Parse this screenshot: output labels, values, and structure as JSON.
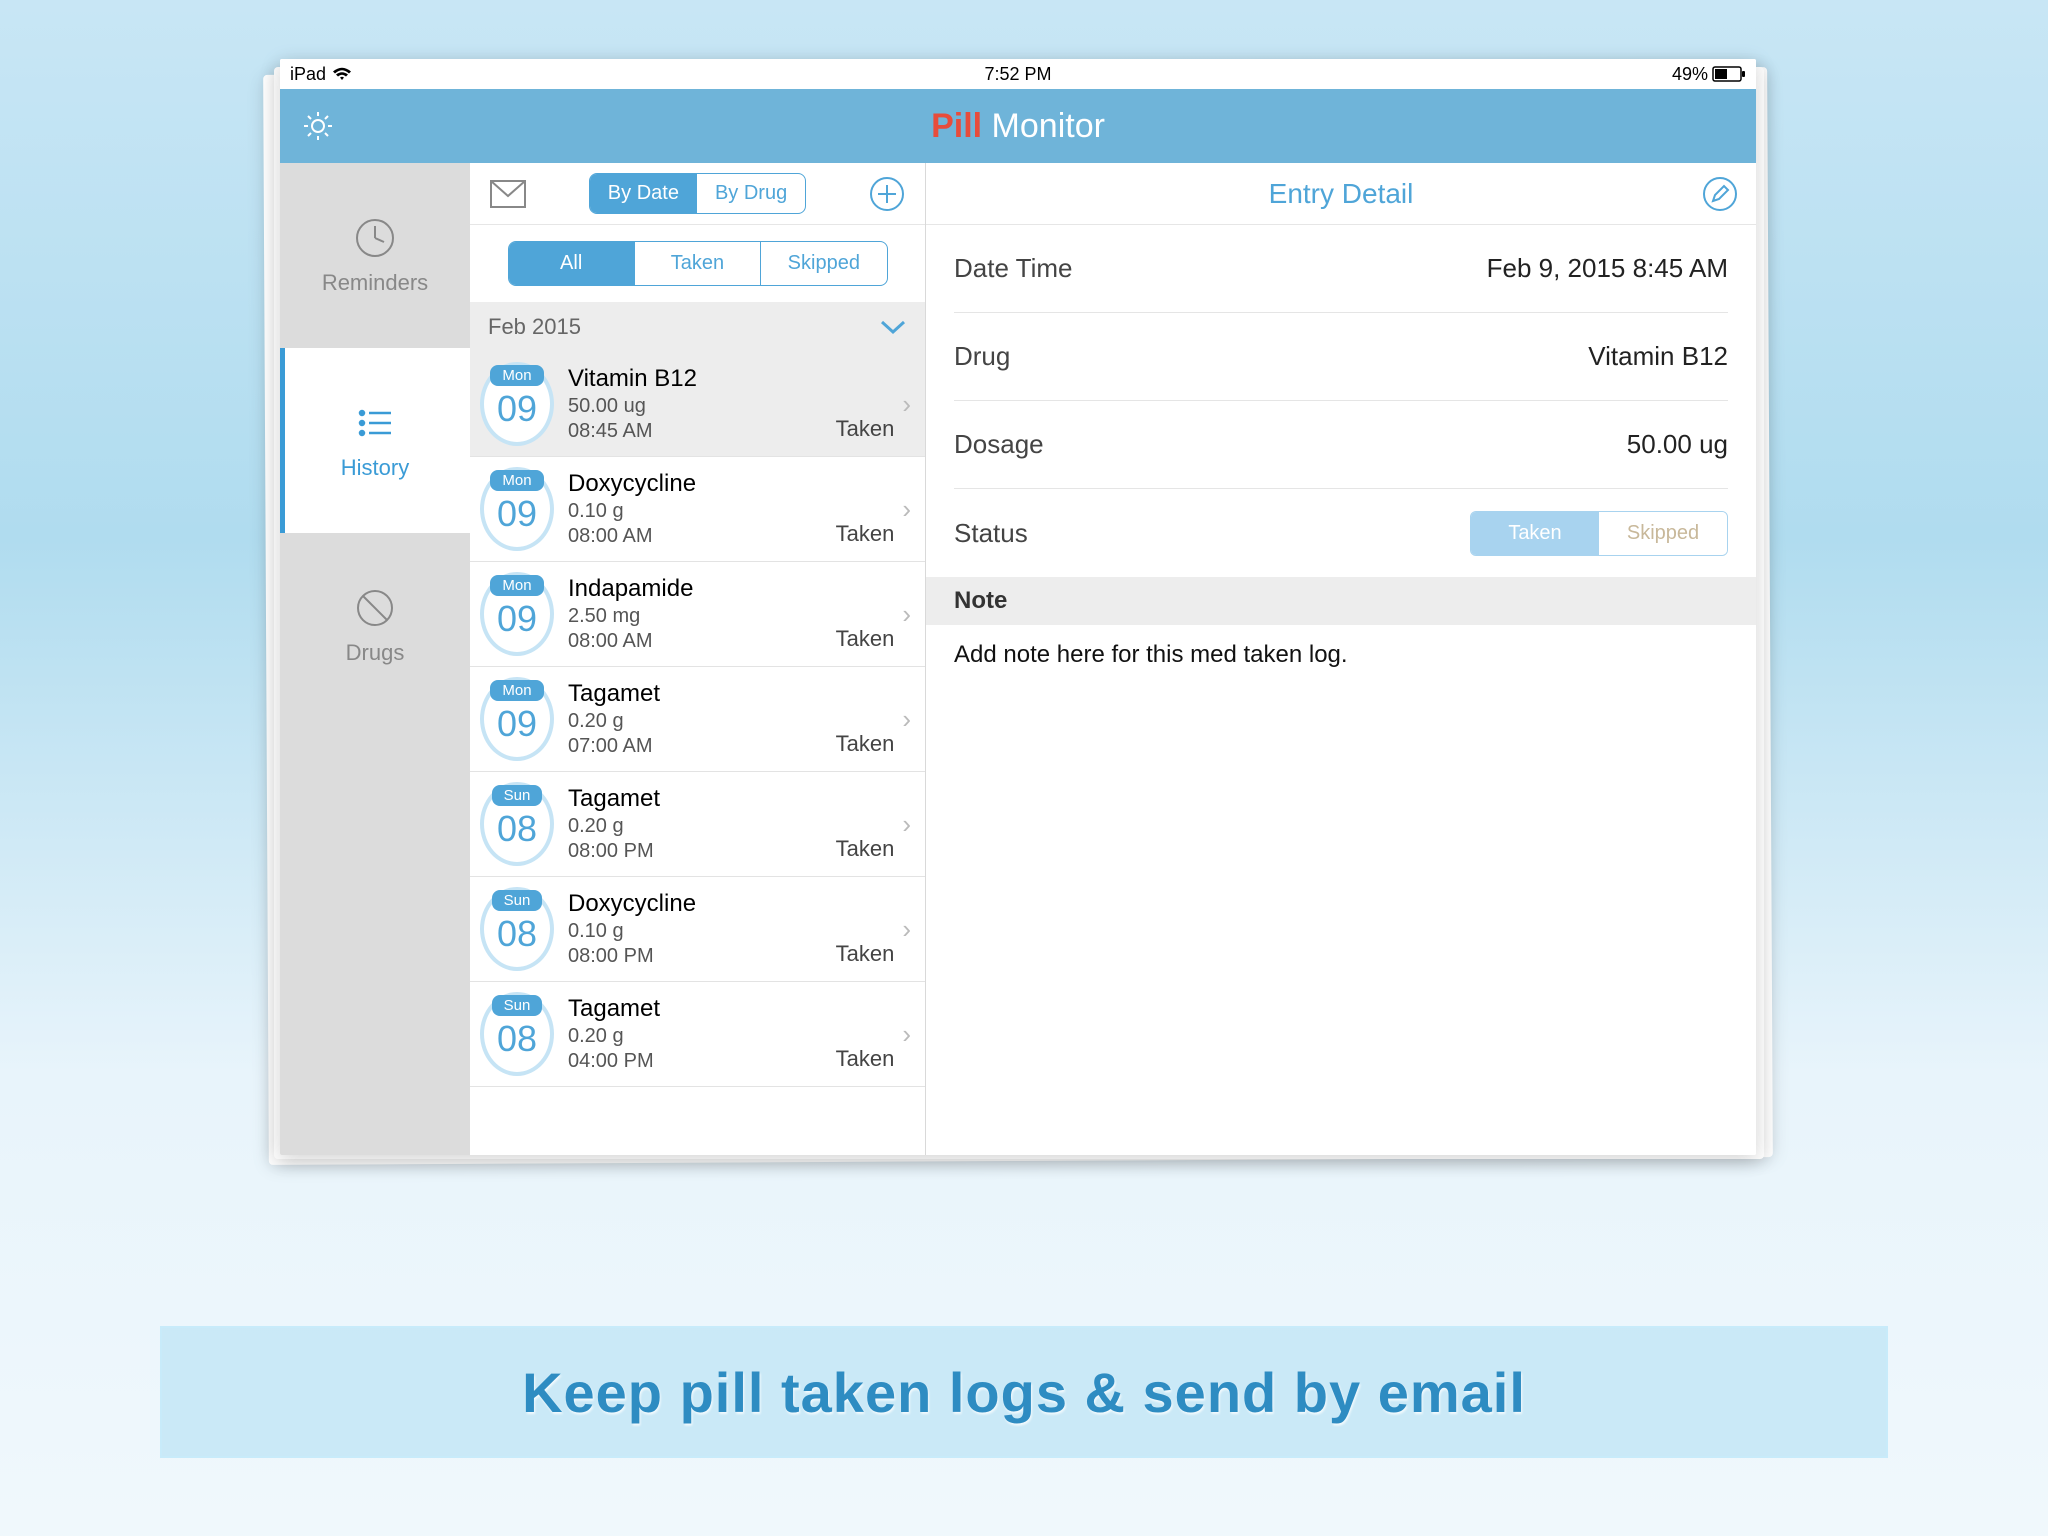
{
  "statusbar": {
    "device": "iPad",
    "time": "7:52 PM",
    "battery": "49%"
  },
  "header": {
    "title_pill": "Pill",
    "title_monitor": " Monitor"
  },
  "nav": {
    "items": [
      {
        "label": "Reminders"
      },
      {
        "label": "History"
      },
      {
        "label": "Drugs"
      }
    ]
  },
  "midheader": {
    "seg1": {
      "by_date": "By Date",
      "by_drug": "By Drug"
    },
    "seg2": {
      "all": "All",
      "taken": "Taken",
      "skipped": "Skipped"
    }
  },
  "month_label": "Feb 2015",
  "entries": [
    {
      "dow": "Mon",
      "day": "09",
      "name": "Vitamin B12",
      "dose": "50.00 ug",
      "time": "08:45 AM",
      "status": "Taken"
    },
    {
      "dow": "Mon",
      "day": "09",
      "name": "Doxycycline",
      "dose": "0.10 g",
      "time": "08:00 AM",
      "status": "Taken"
    },
    {
      "dow": "Mon",
      "day": "09",
      "name": "Indapamide",
      "dose": "2.50 mg",
      "time": "08:00 AM",
      "status": "Taken"
    },
    {
      "dow": "Mon",
      "day": "09",
      "name": "Tagamet",
      "dose": "0.20 g",
      "time": "07:00 AM",
      "status": "Taken"
    },
    {
      "dow": "Sun",
      "day": "08",
      "name": "Tagamet",
      "dose": "0.20 g",
      "time": "08:00 PM",
      "status": "Taken"
    },
    {
      "dow": "Sun",
      "day": "08",
      "name": "Doxycycline",
      "dose": "0.10 g",
      "time": "08:00 PM",
      "status": "Taken"
    },
    {
      "dow": "Sun",
      "day": "08",
      "name": "Tagamet",
      "dose": "0.20 g",
      "time": "04:00 PM",
      "status": "Taken"
    }
  ],
  "detail": {
    "title": "Entry Detail",
    "rows": {
      "datetime_k": "Date Time",
      "datetime_v": "Feb 9, 2015 8:45 AM",
      "drug_k": "Drug",
      "drug_v": "Vitamin B12",
      "dosage_k": "Dosage",
      "dosage_v": "50.00 ug",
      "status_k": "Status",
      "status_taken": "Taken",
      "status_skipped": "Skipped"
    },
    "note_head": "Note",
    "note_body": "Add note here for this med taken log."
  },
  "caption": "Keep pill taken logs & send by email"
}
